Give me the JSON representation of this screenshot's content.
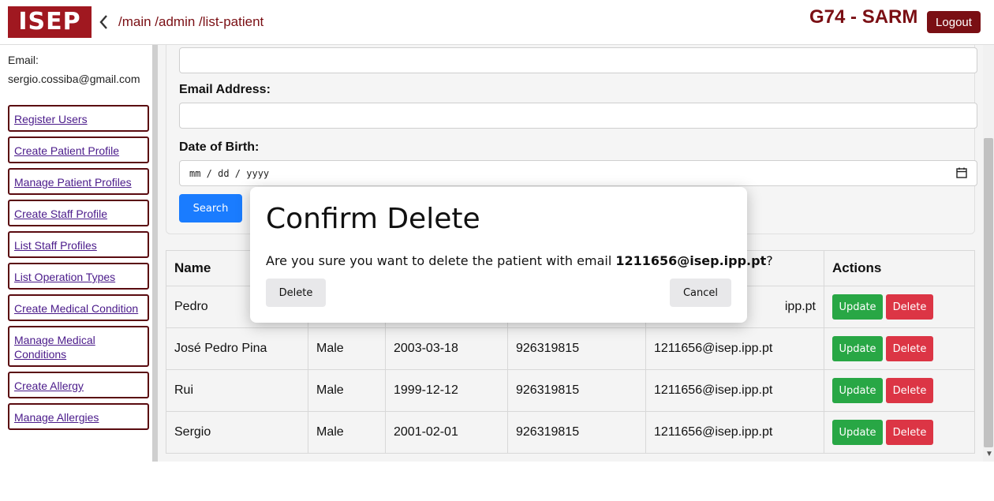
{
  "header": {
    "logo_text": "ISEP",
    "breadcrumb": "/main /admin /list-patient",
    "app_title": "G74 - SARM",
    "logout_label": "Logout",
    "brand_color": "#7a0f14"
  },
  "sidebar": {
    "email_label": "Email:",
    "email_value": "sergio.cossiba@gmail.com",
    "items": [
      {
        "label": "Register Users"
      },
      {
        "label": "Create Patient Profile"
      },
      {
        "label": "Manage Patient Profiles"
      },
      {
        "label": "Create Staff Profile"
      },
      {
        "label": "List Staff Profiles"
      },
      {
        "label": "List Operation Types"
      },
      {
        "label": "Create Medical Condition"
      },
      {
        "label": "Manage Medical Conditions"
      },
      {
        "label": "Create Allergy"
      },
      {
        "label": "Manage Allergies"
      }
    ]
  },
  "form": {
    "email_label": "Email Address:",
    "dob_label": "Date of Birth:",
    "dob_placeholder": "mm / dd / yyyy",
    "search_label": "Search"
  },
  "table": {
    "headers": [
      "Name",
      "",
      "",
      "",
      "",
      "Actions"
    ],
    "rows": [
      {
        "name": "Pedro",
        "gender": "",
        "dob": "",
        "phone": "",
        "email": "ipp.pt"
      },
      {
        "name": "José Pedro Pina",
        "gender": "Male",
        "dob": "2003-03-18",
        "phone": "926319815",
        "email": "1211656@isep.ipp.pt"
      },
      {
        "name": "Rui",
        "gender": "Male",
        "dob": "1999-12-12",
        "phone": "926319815",
        "email": "1211656@isep.ipp.pt"
      },
      {
        "name": "Sergio",
        "gender": "Male",
        "dob": "2001-02-01",
        "phone": "926319815",
        "email": "1211656@isep.ipp.pt"
      }
    ],
    "update_label": "Update",
    "delete_label": "Delete"
  },
  "modal": {
    "title": "Confirm Delete",
    "message_prefix": "Are you sure you want to delete the patient with email ",
    "message_email": "1211656@isep.ipp.pt",
    "message_suffix": "?",
    "delete_label": "Delete",
    "cancel_label": "Cancel"
  }
}
